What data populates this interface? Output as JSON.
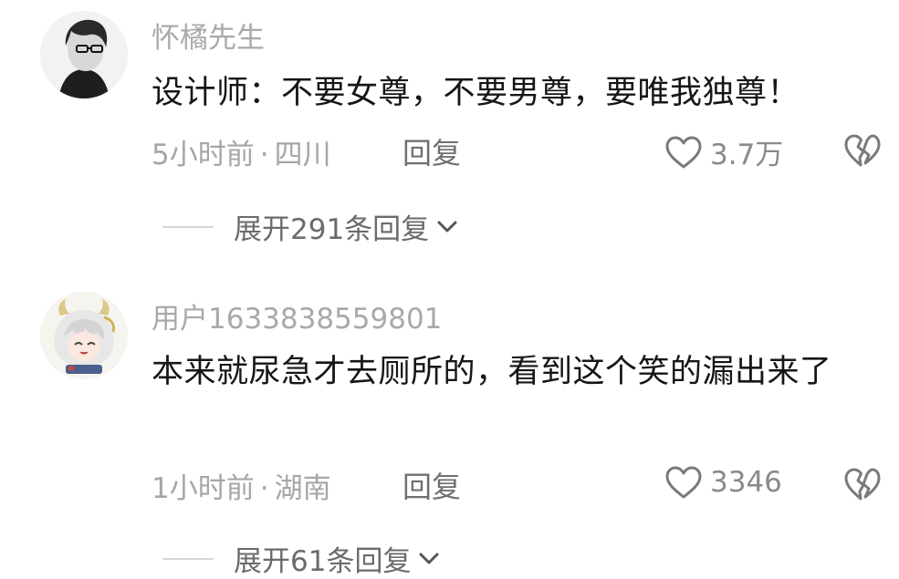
{
  "comments": [
    {
      "username": "怀橘先生",
      "text": "设计师：不要女尊，不要男尊，要唯我独尊！",
      "time": "5小时前",
      "separator": "·",
      "location": "四川",
      "reply_label": "回复",
      "likes": "3.7万",
      "expand_label": "展开291条回复"
    },
    {
      "username": "用户1633838559801",
      "text": "本来就尿急才去厕所的，看到这个笑的漏出来了",
      "time": "1小时前",
      "separator": "·",
      "location": "湖南",
      "reply_label": "回复",
      "likes": "3346",
      "expand_label": "展开61条回复"
    }
  ],
  "icons": {
    "like": "heart-outline-icon",
    "dislike": "broken-heart-icon",
    "expand": "chevron-down-icon"
  },
  "colors": {
    "username": "#a9a9a9",
    "text": "#161616",
    "meta": "#a6a6a6",
    "icon": "#7a7a7a"
  }
}
